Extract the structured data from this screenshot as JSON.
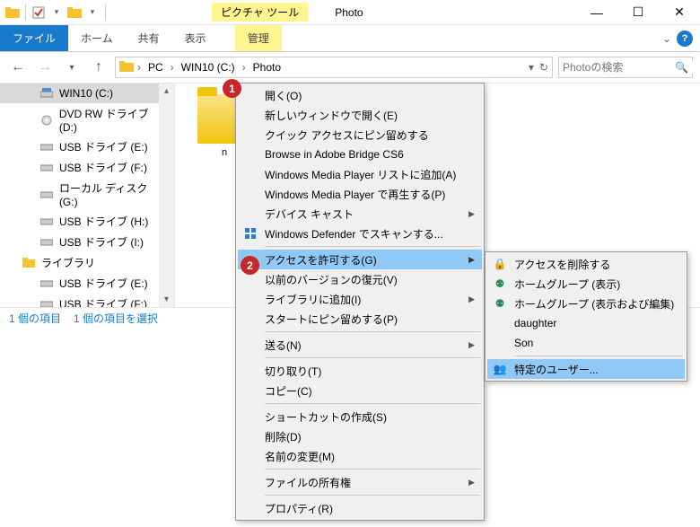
{
  "titlebar": {
    "picture_tools": "ピクチャ ツール",
    "title": "Photo"
  },
  "ribbon": {
    "file": "ファイル",
    "home": "ホーム",
    "share": "共有",
    "view": "表示",
    "manage": "管理"
  },
  "breadcrumb": {
    "pc": "PC",
    "drive": "WIN10 (C:)",
    "folder": "Photo"
  },
  "search": {
    "placeholder": "Photoの検索"
  },
  "tree": {
    "items": [
      {
        "label": "WIN10 (C:)",
        "icon": "disk",
        "selected": true
      },
      {
        "label": "DVD RW ドライブ (D:)",
        "icon": "dvd"
      },
      {
        "label": "USB ドライブ (E:)",
        "icon": "usb"
      },
      {
        "label": "USB ドライブ (F:)",
        "icon": "usb"
      },
      {
        "label": "ローカル ディスク (G:)",
        "icon": "usb"
      },
      {
        "label": "USB ドライブ (H:)",
        "icon": "usb"
      },
      {
        "label": "USB ドライブ (I:)",
        "icon": "usb"
      },
      {
        "label": "ライブラリ",
        "icon": "lib"
      },
      {
        "label": "USB ドライブ (E:)",
        "icon": "usb"
      },
      {
        "label": "USB ドライブ (F:)",
        "icon": "usb"
      }
    ]
  },
  "thumb": {
    "label": "n"
  },
  "status": {
    "items": "1 個の項目",
    "selected": "1 個の項目を選択"
  },
  "context": {
    "open": "開く(O)",
    "open_new_window": "新しいウィンドウで開く(E)",
    "pin_quick_access": "クイック アクセスにピン留めする",
    "browse_bridge": "Browse in Adobe Bridge CS6",
    "wmp_add_list": "Windows Media Player リストに追加(A)",
    "wmp_play": "Windows Media Player で再生する(P)",
    "device_cast": "デバイス キャスト",
    "defender_scan": "Windows Defender でスキャンする...",
    "grant_access": "アクセスを許可する(G)",
    "restore_prev": "以前のバージョンの復元(V)",
    "add_to_library": "ライブラリに追加(I)",
    "pin_start": "スタートにピン留めする(P)",
    "send_to": "送る(N)",
    "cut": "切り取り(T)",
    "copy": "コピー(C)",
    "create_shortcut": "ショートカットの作成(S)",
    "delete": "削除(D)",
    "rename": "名前の変更(M)",
    "file_ownership": "ファイルの所有権",
    "properties": "プロパティ(R)"
  },
  "submenu": {
    "remove_access": "アクセスを削除する",
    "homegroup_view": "ホームグループ (表示)",
    "homegroup_edit": "ホームグループ (表示および編集)",
    "daughter": "daughter",
    "son": "Son",
    "specific_user": "特定のユーザー..."
  },
  "badges": {
    "one": "1",
    "two": "2"
  }
}
